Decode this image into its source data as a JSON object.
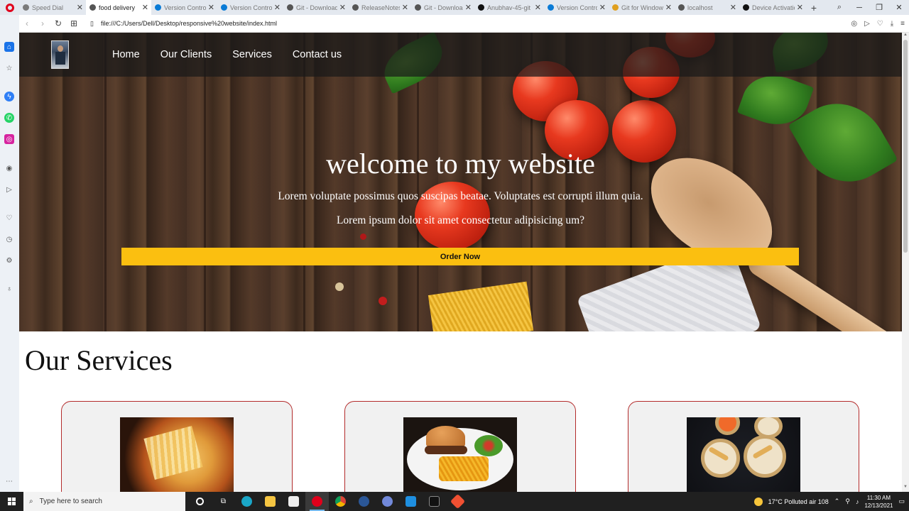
{
  "browser": {
    "tabs": [
      {
        "title": "Speed Dial",
        "active": false,
        "favicon_color": "#7a7a7a"
      },
      {
        "title": "food delivery",
        "active": true,
        "favicon_color": "#555555"
      },
      {
        "title": "Version Control",
        "active": false,
        "favicon_color": "#0a7bd6"
      },
      {
        "title": "Version Control",
        "active": false,
        "favicon_color": "#0a7bd6"
      },
      {
        "title": "Git - Downloads",
        "active": false,
        "favicon_color": "#555555"
      },
      {
        "title": "ReleaseNotes.html",
        "active": false,
        "favicon_color": "#555555"
      },
      {
        "title": "Git - Downloads",
        "active": false,
        "favicon_color": "#555555"
      },
      {
        "title": "Anubhav-45-git",
        "active": false,
        "favicon_color": "#111111"
      },
      {
        "title": "Version Control",
        "active": false,
        "favicon_color": "#0a7bd6"
      },
      {
        "title": "Git for Windows",
        "active": false,
        "favicon_color": "#e0a020"
      },
      {
        "title": "localhost",
        "active": false,
        "favicon_color": "#555555"
      },
      {
        "title": "Device Activation",
        "active": false,
        "favicon_color": "#111111"
      }
    ],
    "new_tab_label": "+",
    "url": "file:///C:/Users/Dell/Desktop/responsive%20website/index.html"
  },
  "site": {
    "nav": [
      "Home",
      "Our Clients",
      "Services",
      "Contact us"
    ],
    "hero": {
      "title": "welcome to my website",
      "line1": "Lorem voluptate possimus quos suscipas beatae. Voluptates est corrupti illum quia.",
      "line2": "Lorem ipsum dolor sit amet consectetur adipisicing um?",
      "button": "Order Now"
    },
    "services_title": "Our Services",
    "services": [
      {
        "image": "pizza"
      },
      {
        "image": "burger-and-fries"
      },
      {
        "image": "spring-rolls"
      }
    ],
    "accent_color": "#fbbf10",
    "card_border_color": "#b32b2b"
  },
  "taskbar": {
    "search_placeholder": "Type here to search",
    "weather": "17°C  Polluted air 108",
    "time": "11:30 AM",
    "date": "12/13/2021"
  }
}
